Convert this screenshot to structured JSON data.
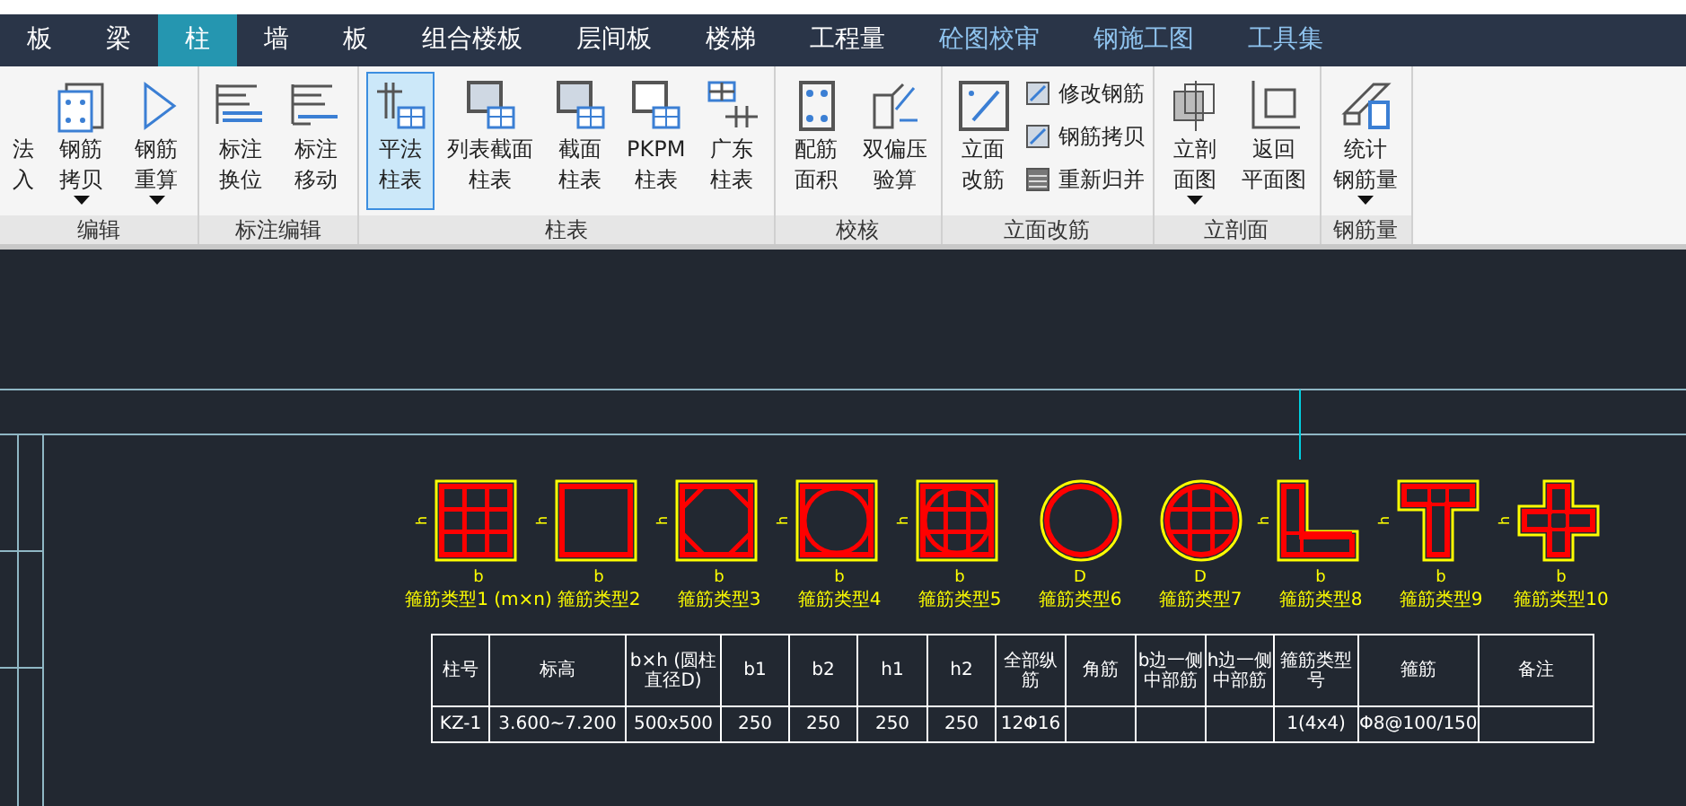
{
  "tabs": [
    {
      "label": "板",
      "selected": false,
      "kind": "module"
    },
    {
      "label": "梁",
      "selected": false,
      "kind": "module"
    },
    {
      "label": "柱",
      "selected": true,
      "kind": "module"
    },
    {
      "label": "墙",
      "selected": false,
      "kind": "module"
    },
    {
      "label": "板",
      "selected": false,
      "kind": "module"
    },
    {
      "label": "组合楼板",
      "selected": false,
      "kind": "module"
    },
    {
      "label": "层间板",
      "selected": false,
      "kind": "module"
    },
    {
      "label": "楼梯",
      "selected": false,
      "kind": "module"
    },
    {
      "label": "工程量",
      "selected": false,
      "kind": "module"
    },
    {
      "label": "砼图校审",
      "selected": false,
      "kind": "addon"
    },
    {
      "label": "钢施工图",
      "selected": false,
      "kind": "addon"
    },
    {
      "label": "工具集",
      "selected": false,
      "kind": "addon"
    }
  ],
  "ribbon": [
    {
      "label": "编辑",
      "buttons": [
        {
          "lines": [
            "法",
            "入"
          ],
          "menu": false,
          "selected": false
        },
        {
          "lines": [
            "钢筋",
            "拷贝"
          ],
          "menu": true,
          "selected": false
        },
        {
          "lines": [
            "钢筋",
            "重算"
          ],
          "menu": true,
          "selected": false
        }
      ]
    },
    {
      "label": "标注编辑",
      "buttons": [
        {
          "lines": [
            "标注",
            "换位"
          ],
          "menu": false,
          "selected": false
        },
        {
          "lines": [
            "标注",
            "移动"
          ],
          "menu": false,
          "selected": false
        }
      ]
    },
    {
      "label": "柱表",
      "buttons": [
        {
          "lines": [
            "平法",
            "柱表"
          ],
          "menu": false,
          "selected": true
        },
        {
          "lines": [
            "列表截面",
            "柱表"
          ],
          "menu": false,
          "selected": false
        },
        {
          "lines": [
            "截面",
            "柱表"
          ],
          "menu": false,
          "selected": false
        },
        {
          "lines": [
            "PKPM",
            "柱表"
          ],
          "menu": false,
          "selected": false
        },
        {
          "lines": [
            "广东",
            "柱表"
          ],
          "menu": false,
          "selected": false
        }
      ]
    },
    {
      "label": "校核",
      "buttons": [
        {
          "lines": [
            "配筋",
            "面积"
          ],
          "menu": false,
          "selected": false
        },
        {
          "lines": [
            "双偏压",
            "验算"
          ],
          "menu": false,
          "selected": false
        }
      ]
    },
    {
      "label": "立面改筋",
      "buttons": [
        {
          "lines": [
            "立面",
            "改筋"
          ],
          "menu": false,
          "selected": false
        }
      ],
      "small_buttons": [
        "修改钢筋",
        "钢筋拷贝",
        "重新归并"
      ]
    },
    {
      "label": "立剖面",
      "buttons": [
        {
          "lines": [
            "立剖",
            "面图"
          ],
          "menu": true,
          "selected": false
        },
        {
          "lines": [
            "返回",
            "平面图"
          ],
          "menu": false,
          "selected": false
        }
      ]
    },
    {
      "label": "钢筋量",
      "buttons": [
        {
          "lines": [
            "统计",
            "钢筋量"
          ],
          "menu": true,
          "selected": false
        }
      ]
    }
  ],
  "sections": [
    {
      "kind": "grid",
      "side": "h",
      "bottom": "b",
      "caption": "箍筋类型1 (m×n)"
    },
    {
      "kind": "square",
      "side": "h",
      "bottom": "b",
      "caption": "箍筋类型2"
    },
    {
      "kind": "octagon",
      "side": "h",
      "bottom": "b",
      "caption": "箍筋类型3"
    },
    {
      "kind": "ring",
      "side": "h",
      "bottom": "b",
      "caption": "箍筋类型4"
    },
    {
      "kind": "ringgrid",
      "side": "h",
      "bottom": "b",
      "caption": "箍筋类型5"
    },
    {
      "kind": "circle",
      "bottom": "D",
      "caption": "箍筋类型6"
    },
    {
      "kind": "circlegrid",
      "bottom": "D",
      "caption": "箍筋类型7"
    },
    {
      "kind": "L",
      "side": "h",
      "bottom": "b",
      "caption": "箍筋类型8"
    },
    {
      "kind": "T",
      "side": "h",
      "bottom": "b",
      "caption": "箍筋类型9"
    },
    {
      "kind": "cross",
      "side": "h",
      "bottom": "b",
      "caption": "箍筋类型10"
    }
  ],
  "table": {
    "columns": [
      "柱号",
      "标高",
      "b×h (圆柱直径D)",
      "b1",
      "b2",
      "h1",
      "h2",
      "全部纵筋",
      "角筋",
      "b边一侧中部筋",
      "h边一侧中部筋",
      "箍筋类型号",
      "箍筋",
      "备注"
    ],
    "rows": [
      [
        "KZ-1",
        "3.600~7.200",
        "500x500",
        "250",
        "250",
        "250",
        "250",
        "12Φ16",
        "",
        "",
        "",
        "1(4x4)",
        "Φ8@100/150",
        ""
      ]
    ]
  }
}
